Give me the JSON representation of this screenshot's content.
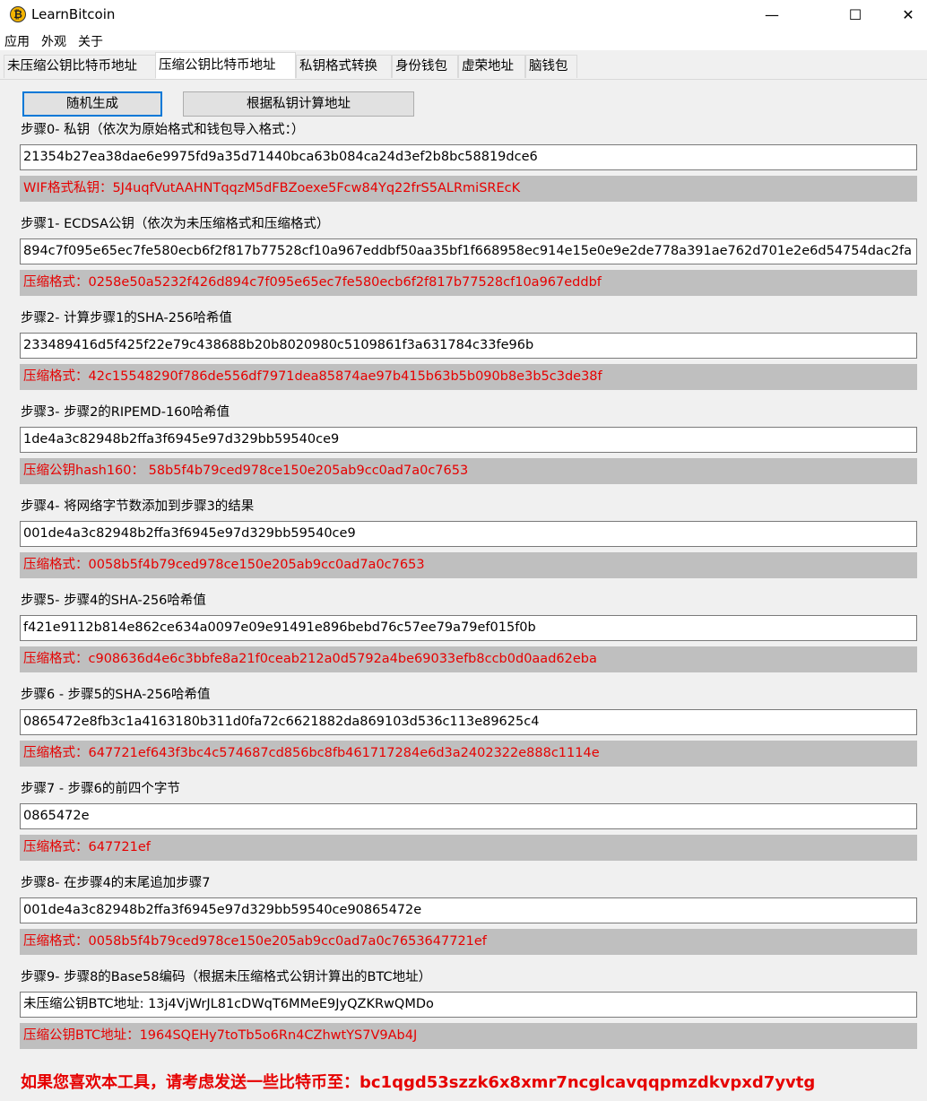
{
  "window": {
    "title": "LearnBitcoin",
    "icon": "bitcoin-icon",
    "icon_glyph": "₿",
    "minimize": "—",
    "maximize": "☐",
    "close": "✕"
  },
  "menu": [
    "应用",
    "外观",
    "关于"
  ],
  "tabs": [
    {
      "label": "未压缩公钥比特币地址",
      "active": false
    },
    {
      "label": "压缩公钥比特币地址",
      "active": true
    },
    {
      "label": "私钥格式转换",
      "active": false
    },
    {
      "label": "身份钱包",
      "active": false
    },
    {
      "label": "虚荣地址",
      "active": false
    },
    {
      "label": "脑钱包",
      "active": false
    }
  ],
  "buttons": {
    "random": "随机生成",
    "compute": "根据私钥计算地址"
  },
  "steps": [
    {
      "label": "步骤0- 私钥（依次为原始格式和钱包导入格式：）",
      "value": "21354b27ea38dae6e9975fd9a35d71440bca63b084ca24d3ef2b8bc58819dce6",
      "result": "WIF格式私钥：5J4uqfVutAAHNTqqzM5dFBZoexe5Fcw84Yq22frS5ALRmiSREcK"
    },
    {
      "label": "步骤1- ECDSA公钥（依次为未压缩格式和压缩格式）",
      "value": "894c7f095e65ec7fe580ecb6f2f817b77528cf10a967eddbf50aa35bf1f668958ec914e15e0e9e2de778a391ae762d701e2e6d54754dac2fa",
      "result": "压缩格式：0258e50a5232f426d894c7f095e65ec7fe580ecb6f2f817b77528cf10a967eddbf"
    },
    {
      "label": "步骤2- 计算步骤1的SHA-256哈希值",
      "value": "233489416d5f425f22e79c438688b20b8020980c5109861f3a631784c33fe96b",
      "result": "压缩格式：42c15548290f786de556df7971dea85874ae97b415b63b5b090b8e3b5c3de38f"
    },
    {
      "label": "步骤3- 步骤2的RIPEMD-160哈希值",
      "value": "1de4a3c82948b2ffa3f6945e97d329bb59540ce9",
      "result": "压缩公钥hash160： 58b5f4b79ced978ce150e205ab9cc0ad7a0c7653"
    },
    {
      "label": "步骤4- 将网络字节数添加到步骤3的结果",
      "value": "001de4a3c82948b2ffa3f6945e97d329bb59540ce9",
      "result": "压缩格式：0058b5f4b79ced978ce150e205ab9cc0ad7a0c7653"
    },
    {
      "label": "步骤5- 步骤4的SHA-256哈希值",
      "value": "f421e9112b814e862ce634a0097e09e91491e896bebd76c57ee79a79ef015f0b",
      "result": "压缩格式：c908636d4e6c3bbfe8a21f0ceab212a0d5792a4be69033efb8ccb0d0aad62eba"
    },
    {
      "label": "步骤6 - 步骤5的SHA-256哈希值",
      "value": "0865472e8fb3c1a4163180b311d0fa72c6621882da869103d536c113e89625c4",
      "result": "压缩格式：647721ef643f3bc4c574687cd856bc8fb461717284e6d3a2402322e888c1114e"
    },
    {
      "label": "步骤7 - 步骤6的前四个字节",
      "value": "0865472e",
      "result": "压缩格式：647721ef"
    },
    {
      "label": "步骤8- 在步骤4的末尾追加步骤7",
      "value": "001de4a3c82948b2ffa3f6945e97d329bb59540ce90865472e",
      "result": "压缩格式：0058b5f4b79ced978ce150e205ab9cc0ad7a0c7653647721ef"
    },
    {
      "label": "步骤9- 步骤8的Base58编码（根据未压缩格式公钥计算出的BTC地址）",
      "value": "未压缩公钥BTC地址: 13j4VjWrJL81cDWqT6MMeE9JyQZKRwQMDo",
      "result": "压缩公钥BTC地址：1964SQEHy7toTb5o6Rn4CZhwtYS7V9Ab4J"
    }
  ],
  "donate": "如果您喜欢本工具，请考虑发送一些比特币至：bc1qgd53szzk6x8xmr7ncglcavqqpmzdkvpxd7yvtg",
  "colors": {
    "result_text": "#e60000",
    "result_bg": "#bfbfbf",
    "focus": "#0078d7"
  }
}
